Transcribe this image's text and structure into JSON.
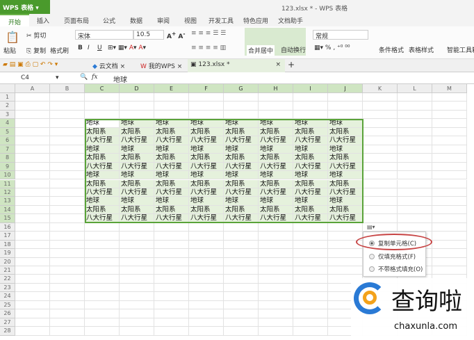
{
  "app": {
    "name": "WPS 表格",
    "window_title": "123.xlsx * - WPS 表格"
  },
  "tabs": [
    "开始",
    "插入",
    "页面布局",
    "公式",
    "数据",
    "审阅",
    "视图",
    "开发工具",
    "特色应用",
    "文档助手"
  ],
  "ribbon": {
    "paste": "粘贴",
    "cut": "剪切",
    "copy": "复制",
    "format_painter": "格式刷",
    "font": "宋体",
    "size": "10.5",
    "merge": "合并居中",
    "wrap": "自动换行",
    "number_format": "常规",
    "cond_format": "条件格式",
    "table_style": "表格样式",
    "smart_tools": "智能工具箱",
    "bold": "B",
    "italic": "I",
    "underline": "U",
    "percent": "%"
  },
  "doc_tabs": [
    "云文档",
    "我的WPS",
    "123.xlsx *"
  ],
  "formula": {
    "cell_ref": "C4",
    "fx": "fx",
    "value": "地球"
  },
  "columns": [
    "A",
    "B",
    "C",
    "D",
    "E",
    "F",
    "G",
    "H",
    "I",
    "J",
    "K",
    "L",
    "M"
  ],
  "rows": 28,
  "cell_pattern": [
    "地球",
    "太阳系",
    "八大行星"
  ],
  "paste_menu": {
    "items": [
      "复制单元格(C)",
      "仅填充格式(F)",
      "不带格式填充(O)"
    ],
    "selected": 0
  },
  "watermark": {
    "text": "查询啦",
    "url": "chaxunla.com"
  },
  "colors": {
    "accent": "#4a9a2c",
    "selection": "#e5f1dc",
    "highlight": "#c74444"
  }
}
